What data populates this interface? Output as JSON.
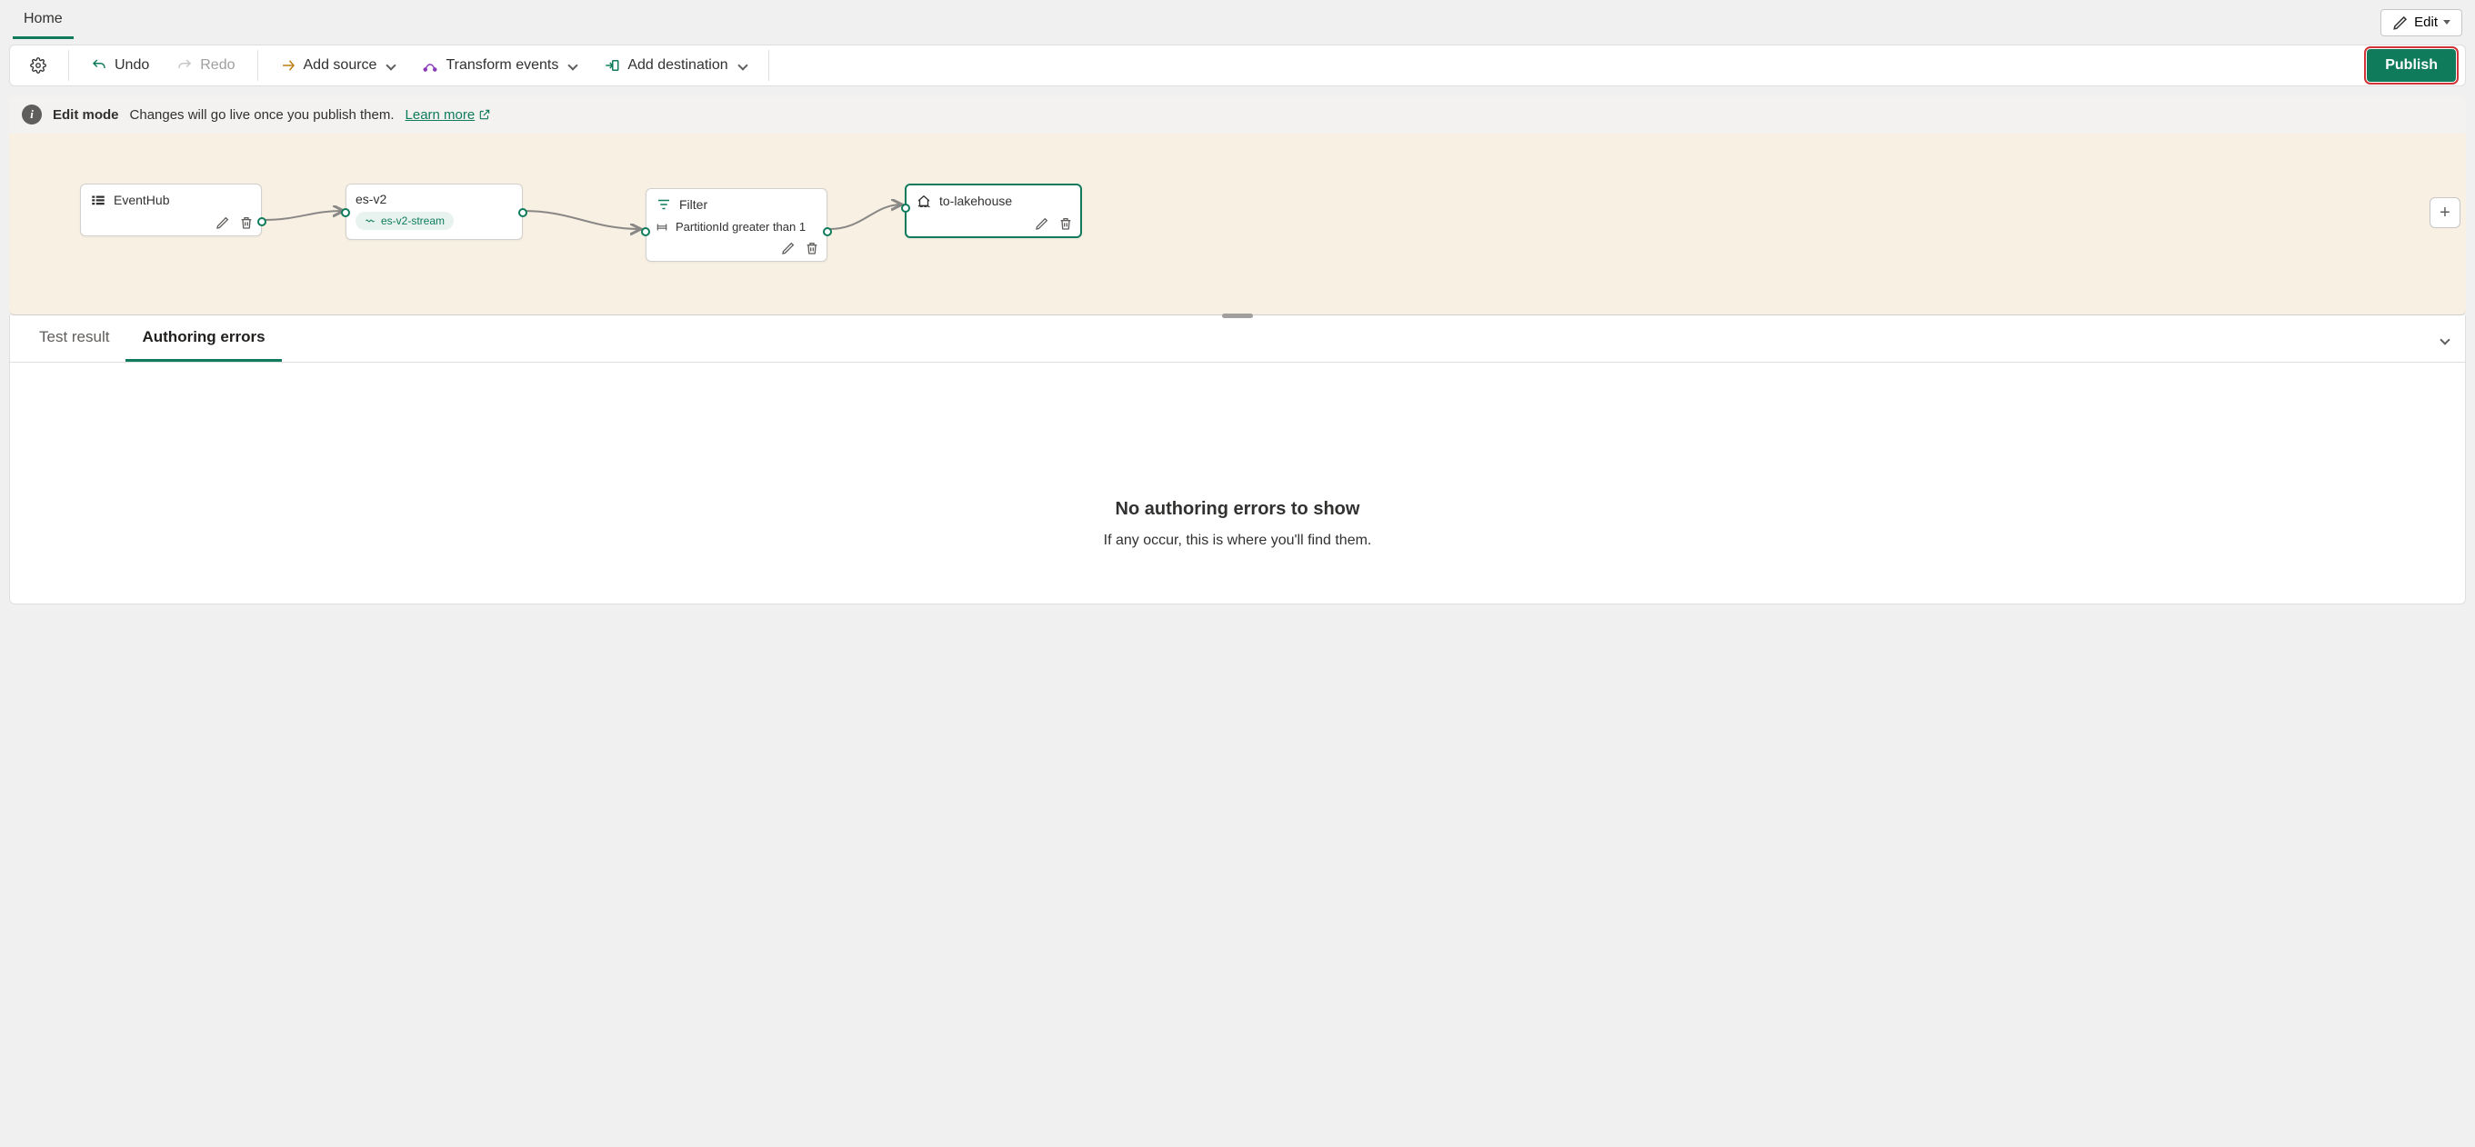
{
  "page_tabs": {
    "home": "Home"
  },
  "edit_button": {
    "label": "Edit"
  },
  "toolbar": {
    "undo": "Undo",
    "redo": "Redo",
    "add_source": "Add source",
    "transform": "Transform events",
    "add_destination": "Add destination",
    "publish": "Publish"
  },
  "info_banner": {
    "title": "Edit mode",
    "message": "Changes will go live once you publish them.",
    "learn_more": "Learn more"
  },
  "nodes": {
    "source": {
      "title": "EventHub"
    },
    "stream": {
      "title": "es-v2",
      "sub": "es-v2-stream"
    },
    "filter": {
      "title": "Filter",
      "condition": "PartitionId greater than 1"
    },
    "dest": {
      "title": "to-lakehouse"
    }
  },
  "bottom_panel": {
    "tabs": {
      "test": "Test result",
      "errors": "Authoring errors"
    },
    "empty_title": "No authoring errors to show",
    "empty_body": "If any occur, this is where you'll find them."
  }
}
